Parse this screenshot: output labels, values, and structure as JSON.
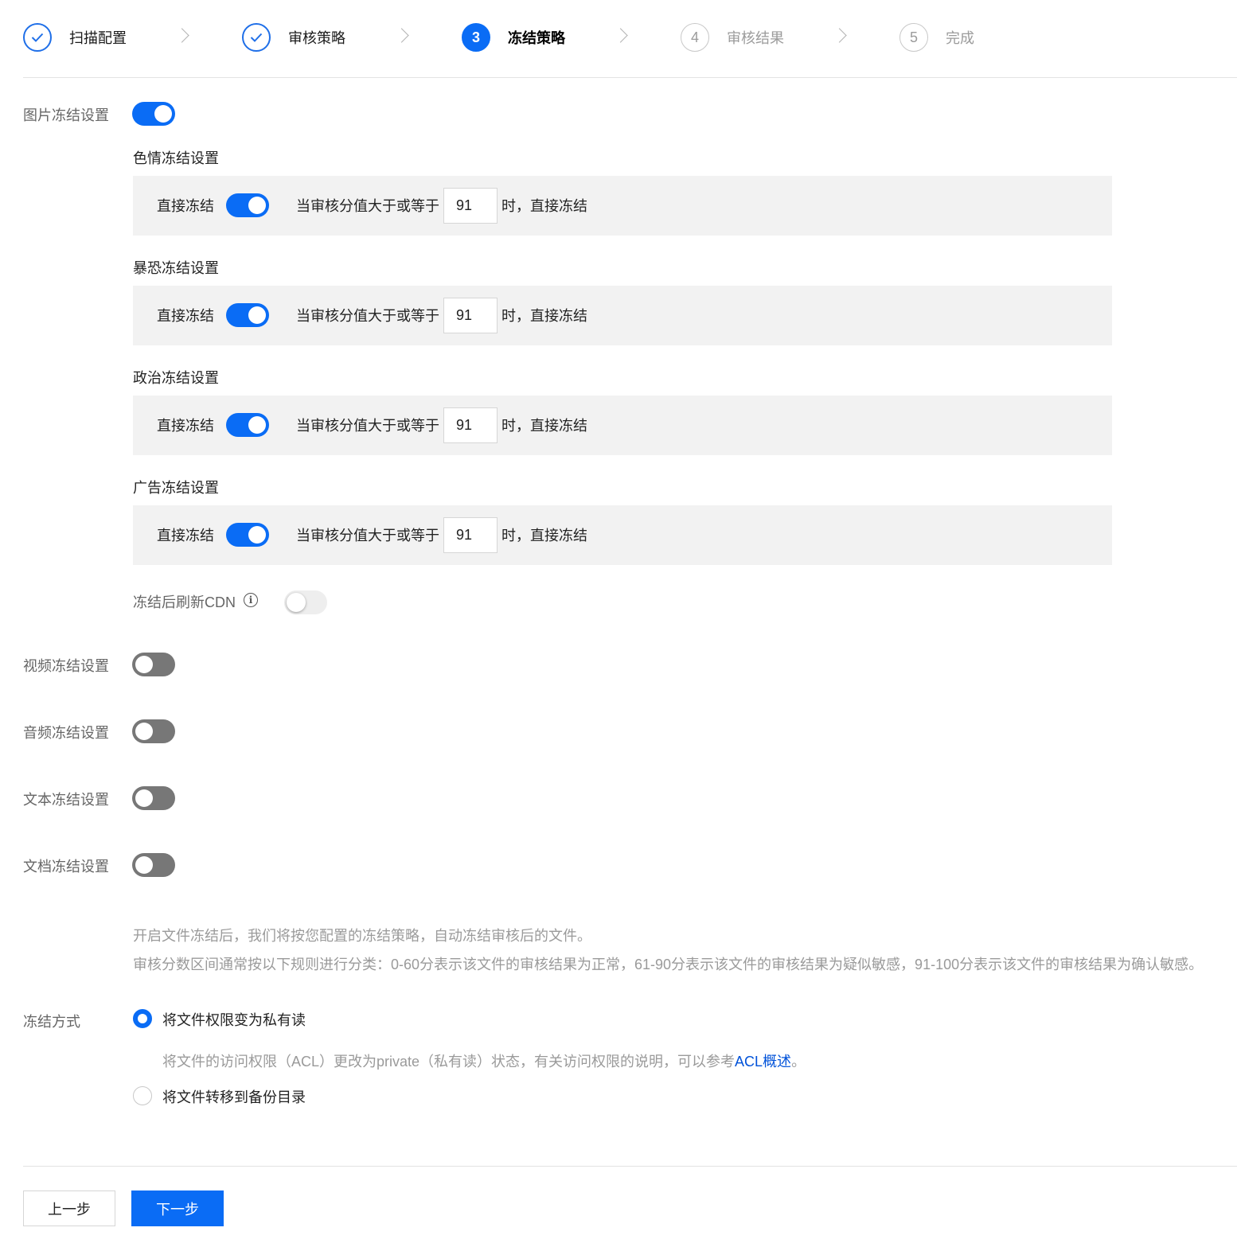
{
  "steps": [
    {
      "label": "扫描配置",
      "number": "",
      "state": "done"
    },
    {
      "label": "审核策略",
      "number": "",
      "state": "done"
    },
    {
      "label": "冻结策略",
      "number": "3",
      "state": "active"
    },
    {
      "label": "审核结果",
      "number": "4",
      "state": "pending"
    },
    {
      "label": "完成",
      "number": "5",
      "state": "pending"
    }
  ],
  "image_freeze": {
    "label": "图片冻结设置",
    "enabled": true,
    "categories": [
      {
        "title": "色情冻结设置",
        "direct_label": "直接冻结",
        "enabled": true,
        "condition_prefix": "当审核分值大于或等于",
        "score": "91",
        "condition_suffix": "时，直接冻结"
      },
      {
        "title": "暴恐冻结设置",
        "direct_label": "直接冻结",
        "enabled": true,
        "condition_prefix": "当审核分值大于或等于",
        "score": "91",
        "condition_suffix": "时，直接冻结"
      },
      {
        "title": "政治冻结设置",
        "direct_label": "直接冻结",
        "enabled": true,
        "condition_prefix": "当审核分值大于或等于",
        "score": "91",
        "condition_suffix": "时，直接冻结"
      },
      {
        "title": "广告冻结设置",
        "direct_label": "直接冻结",
        "enabled": true,
        "condition_prefix": "当审核分值大于或等于",
        "score": "91",
        "condition_suffix": "时，直接冻结"
      }
    ],
    "cdn_refresh": {
      "label": "冻结后刷新CDN",
      "info_icon": "info-icon",
      "enabled": false
    }
  },
  "other_freeze": [
    {
      "label": "视频冻结设置",
      "enabled": false
    },
    {
      "label": "音频冻结设置",
      "enabled": false
    },
    {
      "label": "文本冻结设置",
      "enabled": false
    },
    {
      "label": "文档冻结设置",
      "enabled": false
    }
  ],
  "hints": {
    "line1": "开启文件冻结后，我们将按您配置的冻结策略，自动冻结审核后的文件。",
    "line2": "审核分数区间通常按以下规则进行分类：0-60分表示该文件的审核结果为正常，61-90分表示该文件的审核结果为疑似敏感，91-100分表示该文件的审核结果为确认敏感。"
  },
  "freeze_method": {
    "label": "冻结方式",
    "options": [
      {
        "label": "将文件权限变为私有读",
        "selected": true
      },
      {
        "label": "将文件转移到备份目录",
        "selected": false
      }
    ],
    "description_prefix": "将文件的访问权限（ACL）更改为private（私有读）状态，有关访问权限的说明，可以参考",
    "description_link": "ACL概述",
    "description_suffix": "。"
  },
  "buttons": {
    "prev": "上一步",
    "next": "下一步"
  },
  "colors": {
    "accent": "#0a6cf5",
    "link": "#0052d9",
    "toggle_off": "#777777",
    "panel_bg": "#f2f2f2"
  }
}
